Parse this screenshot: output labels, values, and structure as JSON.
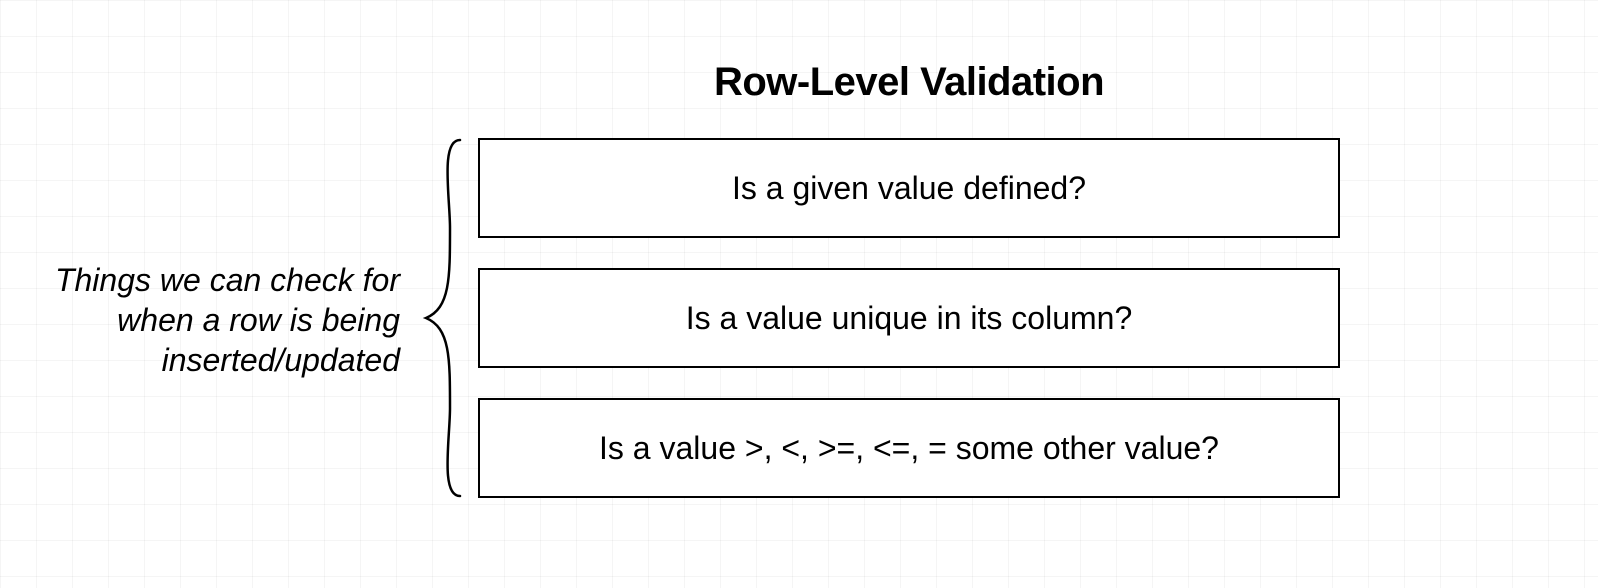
{
  "title": "Row-Level Validation",
  "caption": "Things we can check for when a row is being inserted/updated",
  "boxes": {
    "b0": "Is a given value defined?",
    "b1": "Is a value unique in its column?",
    "b2": "Is a value >, <, >=, <=, = some other value?"
  }
}
